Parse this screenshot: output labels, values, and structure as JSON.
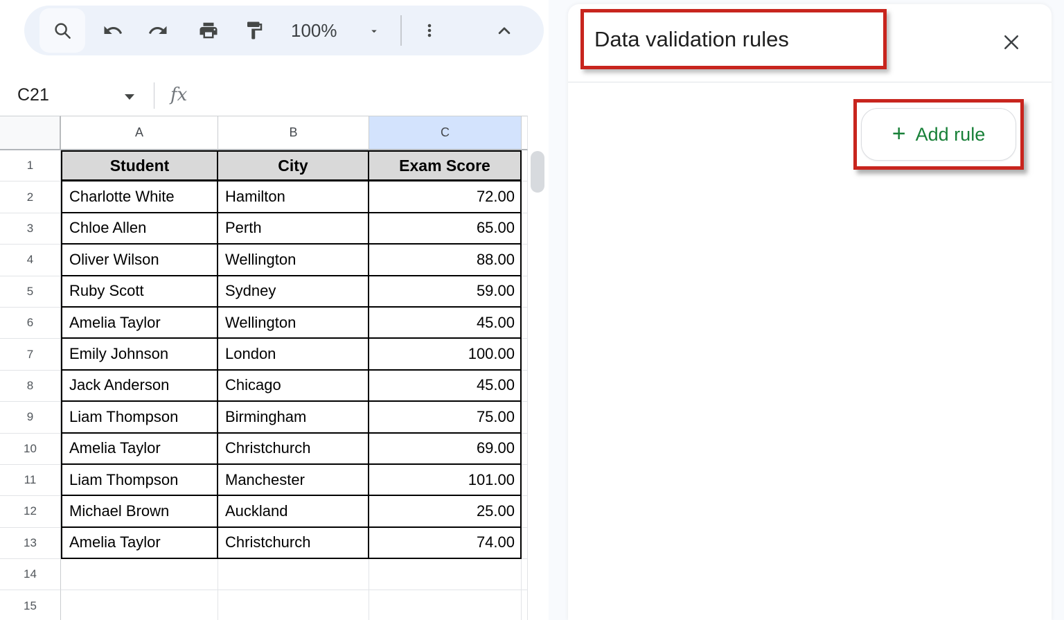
{
  "toolbar": {
    "zoom_level": "100%",
    "icons": [
      "search-icon",
      "undo-icon",
      "redo-icon",
      "print-icon",
      "paint-format-icon",
      "zoom-dropdown-caret",
      "more-vertical-icon",
      "collapse-toolbar-icon"
    ]
  },
  "formula_bar": {
    "cell_reference": "C21",
    "fx_label": "fx"
  },
  "grid": {
    "column_headers": [
      "A",
      "B",
      "C"
    ],
    "selected_column": "C",
    "rows": [
      {
        "n": "1",
        "type": "table-header",
        "cells": [
          "Student",
          "City",
          "Exam Score"
        ]
      },
      {
        "n": "2",
        "type": "data",
        "cells": [
          "Charlotte White",
          "Hamilton",
          "72.00"
        ]
      },
      {
        "n": "3",
        "type": "data",
        "cells": [
          "Chloe Allen",
          "Perth",
          "65.00"
        ]
      },
      {
        "n": "4",
        "type": "data",
        "cells": [
          "Oliver Wilson",
          "Wellington",
          "88.00"
        ]
      },
      {
        "n": "5",
        "type": "data",
        "cells": [
          "Ruby Scott",
          "Sydney",
          "59.00"
        ]
      },
      {
        "n": "6",
        "type": "data",
        "cells": [
          "Amelia Taylor",
          "Wellington",
          "45.00"
        ]
      },
      {
        "n": "7",
        "type": "data",
        "cells": [
          "Emily Johnson",
          "London",
          "100.00"
        ]
      },
      {
        "n": "8",
        "type": "data",
        "cells": [
          "Jack Anderson",
          "Chicago",
          "45.00"
        ]
      },
      {
        "n": "9",
        "type": "data",
        "cells": [
          "Liam Thompson",
          "Birmingham",
          "75.00"
        ]
      },
      {
        "n": "10",
        "type": "data",
        "cells": [
          "Amelia Taylor",
          "Christchurch",
          "69.00"
        ]
      },
      {
        "n": "11",
        "type": "data",
        "cells": [
          "Liam Thompson",
          "Manchester",
          "101.00"
        ]
      },
      {
        "n": "12",
        "type": "data",
        "cells": [
          "Michael Brown",
          "Auckland",
          "25.00"
        ]
      },
      {
        "n": "13",
        "type": "data",
        "cells": [
          "Amelia Taylor",
          "Christchurch",
          "74.00"
        ]
      },
      {
        "n": "14",
        "type": "empty",
        "cells": [
          "",
          "",
          ""
        ]
      },
      {
        "n": "15",
        "type": "empty",
        "cells": [
          "",
          "",
          ""
        ]
      }
    ]
  },
  "panel": {
    "title": "Data validation rules",
    "add_rule": {
      "plus": "+",
      "label": "Add rule"
    }
  },
  "colors": {
    "annotation_red": "#c8251e",
    "accent_green": "#188038",
    "selected_column_blue": "#d3e3fd",
    "table_header_gray": "#d9d9d9",
    "toolbar_pill": "#edf2fa",
    "icon_gray": "#444746"
  }
}
